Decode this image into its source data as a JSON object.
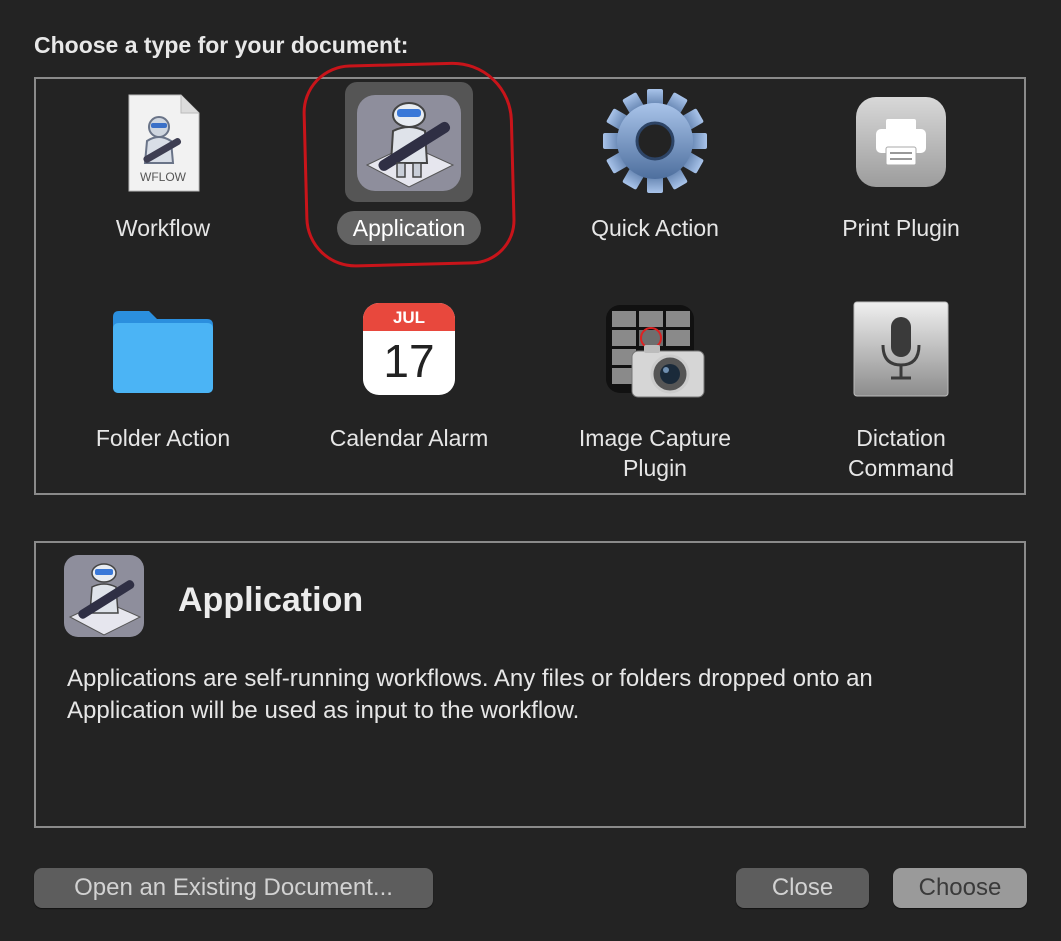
{
  "dialog": {
    "heading": "Choose a type for your document:"
  },
  "types": [
    {
      "label": "Workflow",
      "icon": "workflow-file-icon",
      "badge": "WFLOW"
    },
    {
      "label": "Application",
      "icon": "automator-robot-icon",
      "selected": true
    },
    {
      "label": "Quick Action",
      "icon": "gear-icon"
    },
    {
      "label": "Print Plugin",
      "icon": "printer-icon"
    },
    {
      "label": "Folder Action",
      "icon": "folder-icon"
    },
    {
      "label": "Calendar Alarm",
      "icon": "calendar-icon",
      "month": "JUL",
      "day": "17"
    },
    {
      "label_line1": "Image Capture",
      "label_line2": "Plugin",
      "icon": "image-capture-icon"
    },
    {
      "label_line1": "Dictation",
      "label_line2": "Command",
      "icon": "microphone-icon"
    }
  ],
  "description": {
    "title": "Application",
    "text": "Applications are self-running workflows. Any files or folders dropped onto an Application will be used as input to the workflow."
  },
  "buttons": {
    "open_existing": "Open an Existing Document...",
    "close": "Close",
    "choose": "Choose"
  },
  "colors": {
    "background": "#232323",
    "selection": "#555555",
    "annotation_circle": "#c8141a",
    "folder": "#3fa9f0",
    "calendar_red": "#e8483d"
  }
}
